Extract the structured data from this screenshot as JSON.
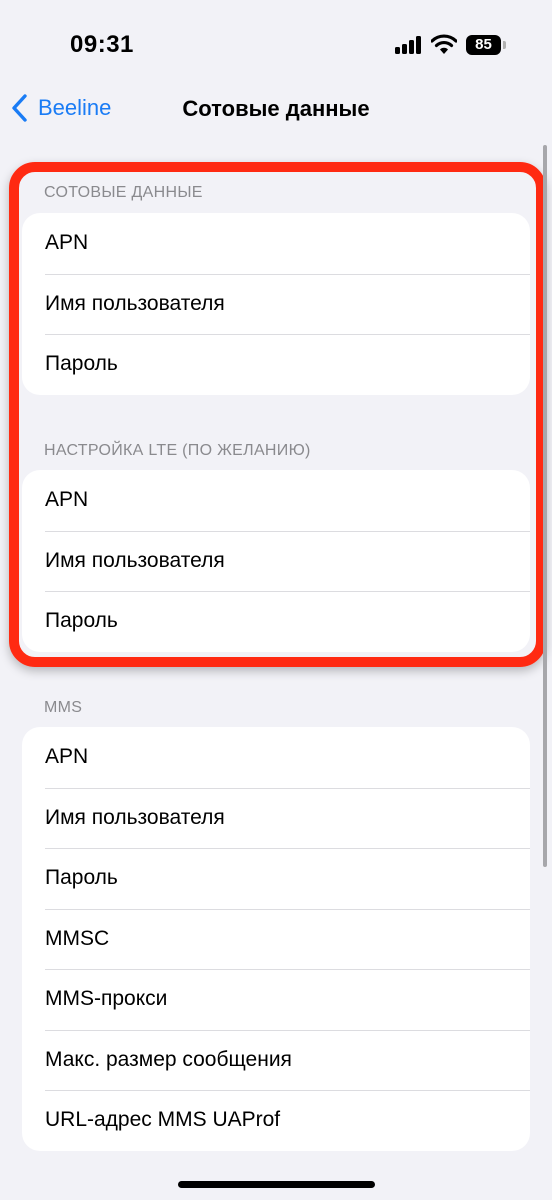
{
  "status_bar": {
    "time": "09:31",
    "battery_level": "85"
  },
  "nav": {
    "back_label": "Beeline",
    "title": "Сотовые данные"
  },
  "sections": [
    {
      "header": "СОТОВЫЕ ДАННЫЕ",
      "items": [
        "APN",
        "Имя пользователя",
        "Пароль"
      ]
    },
    {
      "header": "НАСТРОЙКА LTE (ПО ЖЕЛАНИЮ)",
      "items": [
        "APN",
        "Имя пользователя",
        "Пароль"
      ]
    },
    {
      "header": "MMS",
      "items": [
        "APN",
        "Имя пользователя",
        "Пароль",
        "MMSC",
        "MMS-прокси",
        "Макс. размер сообщения",
        "URL-адрес MMS UAProf"
      ]
    }
  ],
  "colors": {
    "accent": "#1a7cf5",
    "highlight": "#ff2a12",
    "background": "#f2f2f7"
  },
  "icons": {
    "back": "chevron-left-icon",
    "signal": "signal-icon",
    "wifi": "wifi-icon",
    "battery": "battery-icon"
  }
}
